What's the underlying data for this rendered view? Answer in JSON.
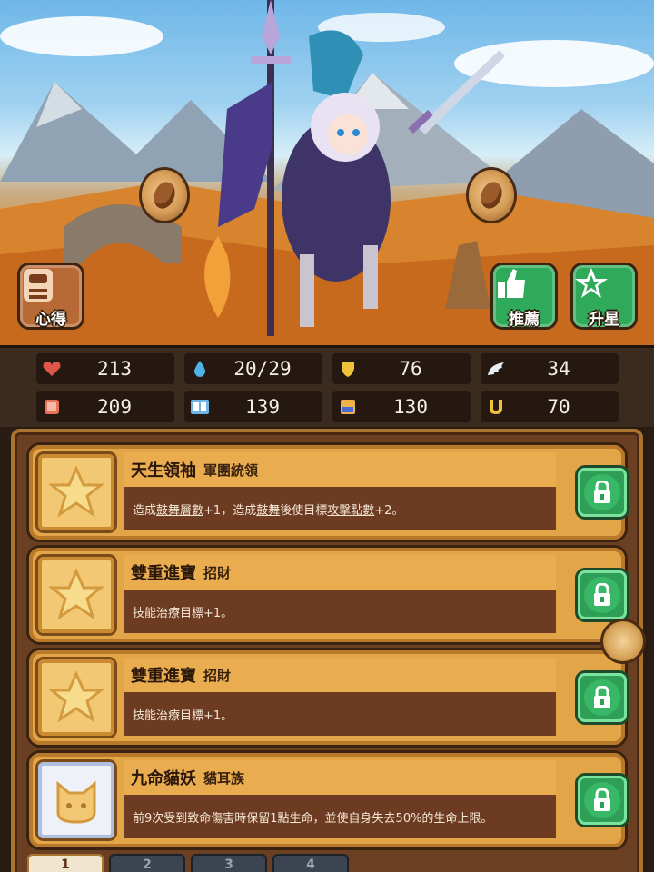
{
  "buttons": {
    "notes_label": "心得",
    "recommend_label": "推薦",
    "star_label": "升星"
  },
  "stats": [
    {
      "icon": "heart-icon",
      "value": "213",
      "color": "#e0564a"
    },
    {
      "icon": "water-drop-icon",
      "value": "20/29",
      "color": "#4fb2e8"
    },
    {
      "icon": "shield-icon",
      "value": "76",
      "color": "#f0c23a"
    },
    {
      "icon": "wing-icon",
      "value": "34",
      "color": "#e8eef4"
    },
    {
      "icon": "fist-icon",
      "value": "209",
      "color": "#e9735a"
    },
    {
      "icon": "book-icon",
      "value": "139",
      "color": "#6fb6e6"
    },
    {
      "icon": "scroll-icon",
      "value": "130",
      "color": "#f0b04a"
    },
    {
      "icon": "horseshoe-icon",
      "value": "70",
      "color": "#f0c23a"
    }
  ],
  "traits": [
    {
      "name": "天生領袖",
      "tag": "軍團統領",
      "desc_parts": [
        "造成",
        "鼓舞層數",
        "+1，造成",
        "鼓舞",
        "後使目標",
        "攻擊點數",
        "+2。"
      ],
      "locked": true
    },
    {
      "name": "雙重進寶",
      "tag": "招財",
      "desc": "技能治療目標+1。",
      "locked": true
    },
    {
      "name": "雙重進寶",
      "tag": "招財",
      "desc": "技能治療目標+1。",
      "locked": true
    },
    {
      "name": "九命貓妖",
      "tag": "貓耳族",
      "desc": "前9次受到致命傷害時保留1點生命，並使自身失去50%的生命上限。",
      "locked": true
    }
  ],
  "tabs": [
    "1",
    "2",
    "3",
    "4"
  ],
  "active_tab": "1"
}
